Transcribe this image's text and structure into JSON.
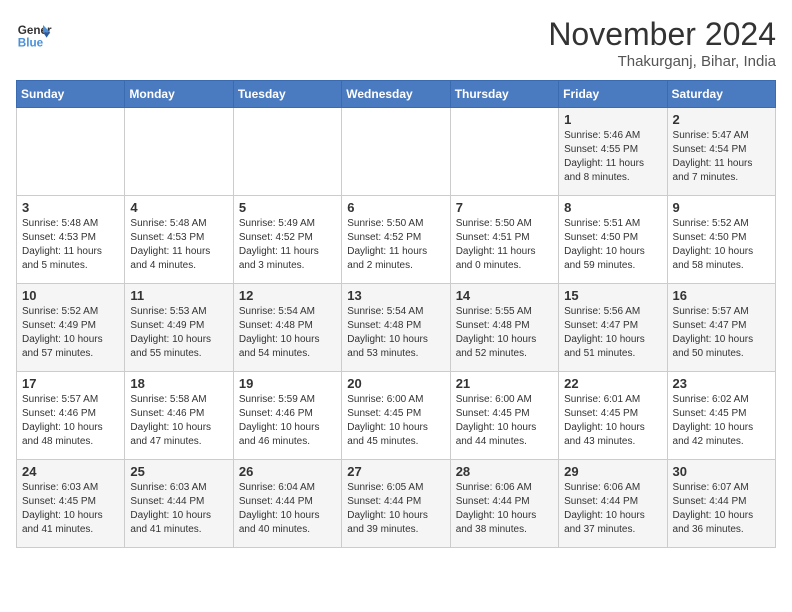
{
  "logo": {
    "line1": "General",
    "line2": "Blue"
  },
  "title": "November 2024",
  "location": "Thakurganj, Bihar, India",
  "days_of_week": [
    "Sunday",
    "Monday",
    "Tuesday",
    "Wednesday",
    "Thursday",
    "Friday",
    "Saturday"
  ],
  "weeks": [
    [
      {
        "day": "",
        "info": ""
      },
      {
        "day": "",
        "info": ""
      },
      {
        "day": "",
        "info": ""
      },
      {
        "day": "",
        "info": ""
      },
      {
        "day": "",
        "info": ""
      },
      {
        "day": "1",
        "info": "Sunrise: 5:46 AM\nSunset: 4:55 PM\nDaylight: 11 hours and 8 minutes."
      },
      {
        "day": "2",
        "info": "Sunrise: 5:47 AM\nSunset: 4:54 PM\nDaylight: 11 hours and 7 minutes."
      }
    ],
    [
      {
        "day": "3",
        "info": "Sunrise: 5:48 AM\nSunset: 4:53 PM\nDaylight: 11 hours and 5 minutes."
      },
      {
        "day": "4",
        "info": "Sunrise: 5:48 AM\nSunset: 4:53 PM\nDaylight: 11 hours and 4 minutes."
      },
      {
        "day": "5",
        "info": "Sunrise: 5:49 AM\nSunset: 4:52 PM\nDaylight: 11 hours and 3 minutes."
      },
      {
        "day": "6",
        "info": "Sunrise: 5:50 AM\nSunset: 4:52 PM\nDaylight: 11 hours and 2 minutes."
      },
      {
        "day": "7",
        "info": "Sunrise: 5:50 AM\nSunset: 4:51 PM\nDaylight: 11 hours and 0 minutes."
      },
      {
        "day": "8",
        "info": "Sunrise: 5:51 AM\nSunset: 4:50 PM\nDaylight: 10 hours and 59 minutes."
      },
      {
        "day": "9",
        "info": "Sunrise: 5:52 AM\nSunset: 4:50 PM\nDaylight: 10 hours and 58 minutes."
      }
    ],
    [
      {
        "day": "10",
        "info": "Sunrise: 5:52 AM\nSunset: 4:49 PM\nDaylight: 10 hours and 57 minutes."
      },
      {
        "day": "11",
        "info": "Sunrise: 5:53 AM\nSunset: 4:49 PM\nDaylight: 10 hours and 55 minutes."
      },
      {
        "day": "12",
        "info": "Sunrise: 5:54 AM\nSunset: 4:48 PM\nDaylight: 10 hours and 54 minutes."
      },
      {
        "day": "13",
        "info": "Sunrise: 5:54 AM\nSunset: 4:48 PM\nDaylight: 10 hours and 53 minutes."
      },
      {
        "day": "14",
        "info": "Sunrise: 5:55 AM\nSunset: 4:48 PM\nDaylight: 10 hours and 52 minutes."
      },
      {
        "day": "15",
        "info": "Sunrise: 5:56 AM\nSunset: 4:47 PM\nDaylight: 10 hours and 51 minutes."
      },
      {
        "day": "16",
        "info": "Sunrise: 5:57 AM\nSunset: 4:47 PM\nDaylight: 10 hours and 50 minutes."
      }
    ],
    [
      {
        "day": "17",
        "info": "Sunrise: 5:57 AM\nSunset: 4:46 PM\nDaylight: 10 hours and 48 minutes."
      },
      {
        "day": "18",
        "info": "Sunrise: 5:58 AM\nSunset: 4:46 PM\nDaylight: 10 hours and 47 minutes."
      },
      {
        "day": "19",
        "info": "Sunrise: 5:59 AM\nSunset: 4:46 PM\nDaylight: 10 hours and 46 minutes."
      },
      {
        "day": "20",
        "info": "Sunrise: 6:00 AM\nSunset: 4:45 PM\nDaylight: 10 hours and 45 minutes."
      },
      {
        "day": "21",
        "info": "Sunrise: 6:00 AM\nSunset: 4:45 PM\nDaylight: 10 hours and 44 minutes."
      },
      {
        "day": "22",
        "info": "Sunrise: 6:01 AM\nSunset: 4:45 PM\nDaylight: 10 hours and 43 minutes."
      },
      {
        "day": "23",
        "info": "Sunrise: 6:02 AM\nSunset: 4:45 PM\nDaylight: 10 hours and 42 minutes."
      }
    ],
    [
      {
        "day": "24",
        "info": "Sunrise: 6:03 AM\nSunset: 4:45 PM\nDaylight: 10 hours and 41 minutes."
      },
      {
        "day": "25",
        "info": "Sunrise: 6:03 AM\nSunset: 4:44 PM\nDaylight: 10 hours and 41 minutes."
      },
      {
        "day": "26",
        "info": "Sunrise: 6:04 AM\nSunset: 4:44 PM\nDaylight: 10 hours and 40 minutes."
      },
      {
        "day": "27",
        "info": "Sunrise: 6:05 AM\nSunset: 4:44 PM\nDaylight: 10 hours and 39 minutes."
      },
      {
        "day": "28",
        "info": "Sunrise: 6:06 AM\nSunset: 4:44 PM\nDaylight: 10 hours and 38 minutes."
      },
      {
        "day": "29",
        "info": "Sunrise: 6:06 AM\nSunset: 4:44 PM\nDaylight: 10 hours and 37 minutes."
      },
      {
        "day": "30",
        "info": "Sunrise: 6:07 AM\nSunset: 4:44 PM\nDaylight: 10 hours and 36 minutes."
      }
    ]
  ]
}
